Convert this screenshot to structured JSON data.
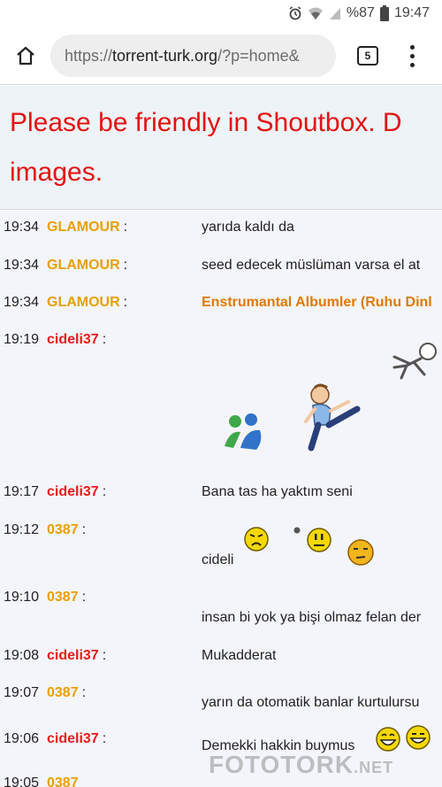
{
  "status_bar": {
    "battery": "%87",
    "time": "19:47"
  },
  "browser": {
    "url_scheme": "https://",
    "url_host": "torrent-turk.org",
    "url_rest": "/?p=home&",
    "tab_count": "5"
  },
  "banner": {
    "text": "Please be friendly in Shoutbox. D images."
  },
  "shouts": [
    {
      "time": "19:34",
      "user": "GLAMOUR",
      "message": "yarıda kaldı da"
    },
    {
      "time": "19:34",
      "user": "GLAMOUR",
      "message": "seed edecek müslüman varsa el at"
    },
    {
      "time": "19:34",
      "user": "GLAMOUR",
      "message": "Enstrumantal Albumler (Ruhu Dinl"
    },
    {
      "time": "19:19",
      "user": "cideli37",
      "message": ""
    },
    {
      "time": "19:17",
      "user": "cideli37",
      "message": "Bana tas ha yaktım seni"
    },
    {
      "time": "19:12",
      "user": "0387",
      "message": "cideli"
    },
    {
      "time": "19:10",
      "user": "0387",
      "message": "insan bi yok ya bişi olmaz felan der"
    },
    {
      "time": "19:08",
      "user": "cideli37",
      "message": "Mukadderat"
    },
    {
      "time": "19:07",
      "user": "0387",
      "message": "yarın da otomatik banlar kurtulursu"
    },
    {
      "time": "19:06",
      "user": "cideli37",
      "message": "Demekki hakkin buymus"
    },
    {
      "time": "19:05",
      "user": "0387",
      "message": ""
    }
  ],
  "separator": ":",
  "watermark": {
    "main": "FOTOTORK",
    "suffix": ".NET"
  }
}
